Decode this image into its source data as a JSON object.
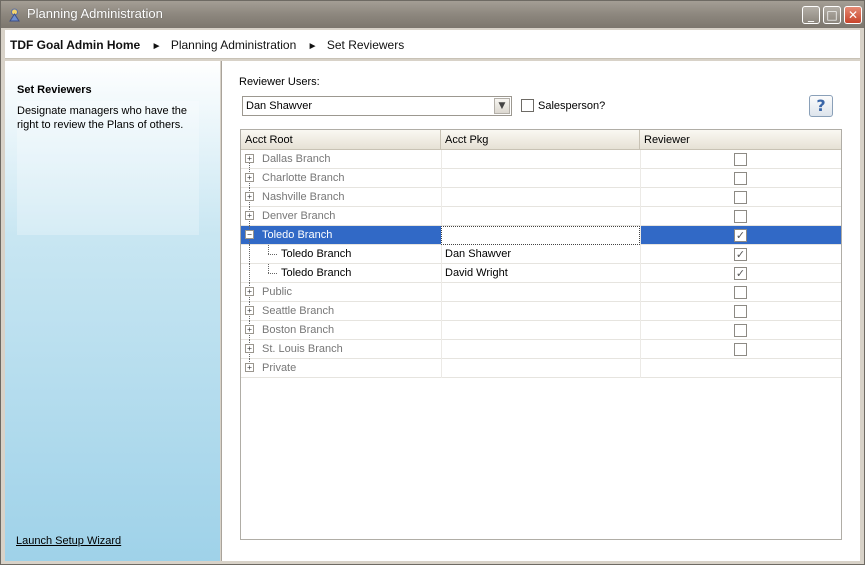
{
  "window": {
    "title": "Planning Administration",
    "controls": [
      "minimize",
      "maximize",
      "close"
    ]
  },
  "breadcrumb": {
    "home": "TDF Goal Admin Home",
    "items": [
      "Planning Administration",
      "Set Reviewers"
    ],
    "separator": "►"
  },
  "sidebar": {
    "heading": "Set Reviewers",
    "description": "Designate managers who have the right to review the Plans of others.",
    "launch_link": "Launch Setup Wizard"
  },
  "main": {
    "reviewer_label": "Reviewer Users:",
    "reviewer_selected": "Dan Shawver",
    "salesperson_label": "Salesperson?",
    "salesperson_checked": false,
    "help_symbol": "?"
  },
  "grid": {
    "columns": [
      "Acct Root",
      "Acct Pkg",
      "Reviewer"
    ],
    "rows": [
      {
        "root": "Dallas Branch",
        "pkg": "",
        "reviewer": false,
        "level": 0,
        "expander": "+"
      },
      {
        "root": "Charlotte Branch",
        "pkg": "",
        "reviewer": false,
        "level": 0,
        "expander": "+"
      },
      {
        "root": "Nashville Branch",
        "pkg": "",
        "reviewer": false,
        "level": 0,
        "expander": "+"
      },
      {
        "root": "Denver Branch",
        "pkg": "",
        "reviewer": false,
        "level": 0,
        "expander": "+"
      },
      {
        "root": "Toledo Branch",
        "pkg": "",
        "reviewer": true,
        "level": 0,
        "expander": "−",
        "selected": true
      },
      {
        "root": "Toledo Branch",
        "pkg": "Dan Shawver",
        "reviewer": true,
        "level": 1
      },
      {
        "root": "Toledo Branch",
        "pkg": "David Wright",
        "reviewer": true,
        "level": 1
      },
      {
        "root": "Public",
        "pkg": "",
        "reviewer": false,
        "level": 0,
        "expander": "+"
      },
      {
        "root": "Seattle Branch",
        "pkg": "",
        "reviewer": false,
        "level": 0,
        "expander": "+"
      },
      {
        "root": "Boston Branch",
        "pkg": "",
        "reviewer": false,
        "level": 0,
        "expander": "+"
      },
      {
        "root": "St. Louis Branch",
        "pkg": "",
        "reviewer": false,
        "level": 0,
        "expander": "+"
      },
      {
        "root": "Private",
        "pkg": "",
        "reviewer": null,
        "level": 0,
        "expander": "+"
      }
    ]
  },
  "colors": {
    "selection": "#3169c6",
    "sidebar_gradient_end": "#9fd2e9",
    "titlebar": "#8d877e"
  }
}
